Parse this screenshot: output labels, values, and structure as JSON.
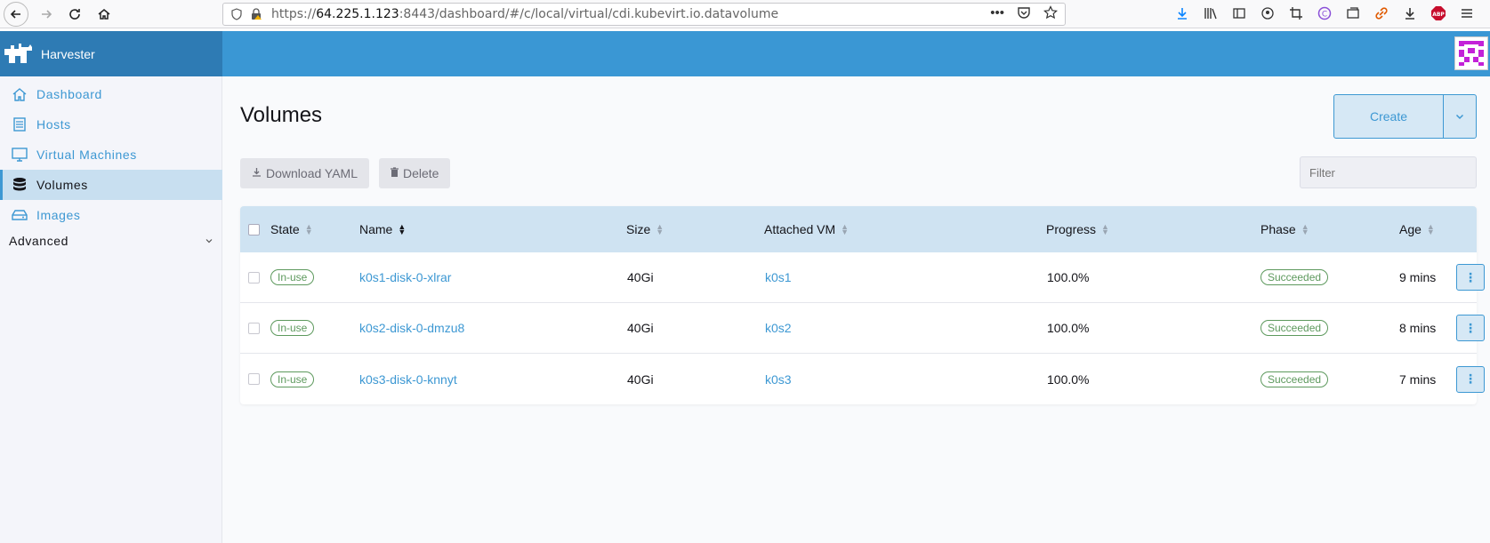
{
  "browser": {
    "url_prefix": "https://",
    "url_host": "64.225.1.123",
    "url_rest": ":8443/dashboard/#/c/local/virtual/cdi.kubevirt.io.datavolume"
  },
  "app": {
    "brand": "Harvester"
  },
  "sidebar": {
    "items": [
      {
        "label": "Dashboard",
        "icon": "home-icon"
      },
      {
        "label": "Hosts",
        "icon": "hosts-icon"
      },
      {
        "label": "Virtual Machines",
        "icon": "monitor-icon"
      },
      {
        "label": "Volumes",
        "icon": "database-icon"
      },
      {
        "label": "Images",
        "icon": "images-icon"
      }
    ],
    "group_label": "Advanced"
  },
  "page": {
    "title": "Volumes",
    "create_label": "Create",
    "download_label": "Download YAML",
    "delete_label": "Delete",
    "filter_placeholder": "Filter"
  },
  "table": {
    "headers": [
      "State",
      "Name",
      "Size",
      "Attached VM",
      "Progress",
      "Phase",
      "Age"
    ],
    "rows": [
      {
        "state": "In-use",
        "name": "k0s1-disk-0-xlrar",
        "size": "40Gi",
        "vm": "k0s1",
        "progress": "100.0%",
        "phase": "Succeeded",
        "age": "9 mins"
      },
      {
        "state": "In-use",
        "name": "k0s2-disk-0-dmzu8",
        "size": "40Gi",
        "vm": "k0s2",
        "progress": "100.0%",
        "phase": "Succeeded",
        "age": "8 mins"
      },
      {
        "state": "In-use",
        "name": "k0s3-disk-0-knnyt",
        "size": "40Gi",
        "vm": "k0s3",
        "progress": "100.0%",
        "phase": "Succeeded",
        "age": "7 mins"
      }
    ]
  },
  "colors": {
    "accent": "#3d98d3",
    "header": "#3a97d4",
    "brand_bg": "#2e7bb4",
    "success": "#5d995d"
  }
}
